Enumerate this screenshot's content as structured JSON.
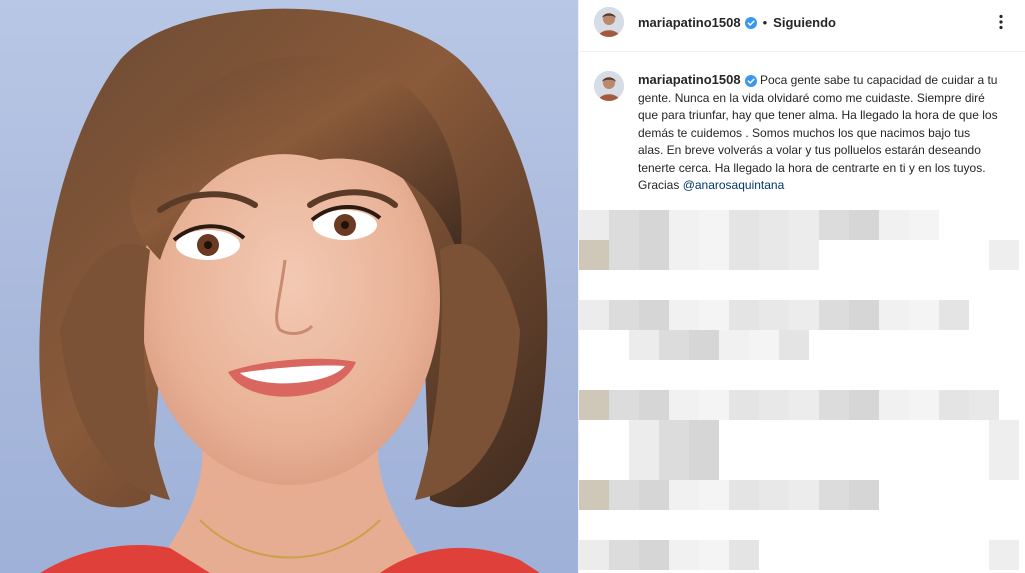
{
  "post": {
    "author": {
      "username": "mariapatino1508",
      "verified": true,
      "follow_status": "Siguiendo"
    },
    "caption": {
      "username": "mariapatino1508",
      "text": "Poca gente sabe tu capacidad de cuidar a tu gente. Nunca en la vida olvidaré como me cuidaste. Siempre diré que para triunfar, hay que tener alma. Ha llegado la hora de que los demás te cuidemos . Somos muchos los que nacimos bajo tus alas. En breve volverás a volar y tus polluelos estarán deseando tenerte cerca. Ha llegado la hora de centrarte en ti y en los tuyos. Gracias",
      "mention": "@anarosaquintana"
    },
    "separator": "•",
    "icons": {
      "verified": "verified-badge-icon",
      "more": "more-options-icon"
    },
    "colors": {
      "verified": "#3897f0",
      "mention": "#00376b",
      "photo_background": "#a9b9dc",
      "dress": "#e0403a"
    },
    "comments_pixelated": true
  }
}
